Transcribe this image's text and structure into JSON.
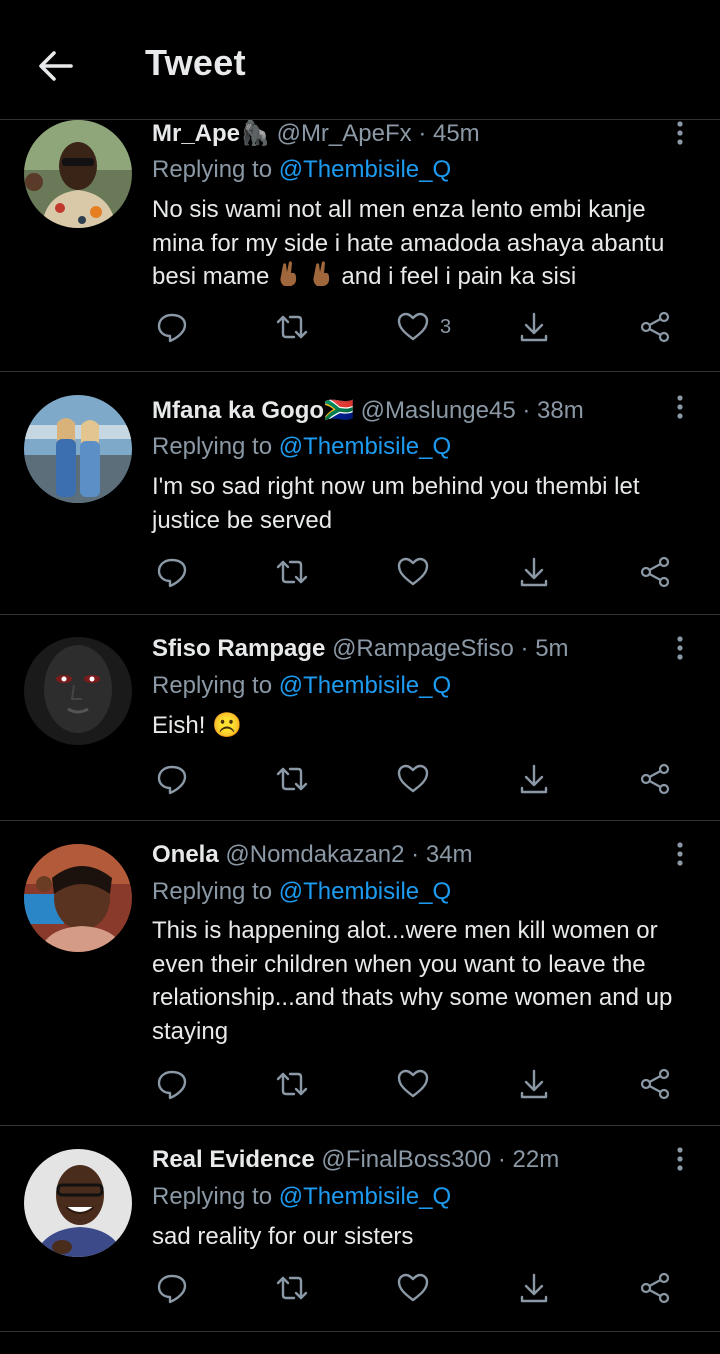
{
  "header": {
    "title": "Tweet"
  },
  "tweets": [
    {
      "name": "Mr_Ape🦍",
      "handle": "@Mr_ApeFx",
      "dot": "·",
      "time": "45m",
      "replying_prefix": "Replying to",
      "replying_to": "@Thembisile_Q",
      "text_line1": "No sis wami not all men enza lento embi kanje mina for my side i hate amadoda ashaya abantu besi mame",
      "text_line2": "and i feel i pain ka sisi",
      "like_count": "3"
    },
    {
      "name": "Mfana ka Gogo🇿🇦",
      "handle": "@Maslunge45",
      "dot": "·",
      "time": "38m",
      "replying_prefix": "Replying to",
      "replying_to": "@Thembisile_Q",
      "text": "I'm so sad right now um behind you thembi let justice be served"
    },
    {
      "name": "Sfiso Rampage",
      "handle": "@RampageSfiso",
      "dot": "·",
      "time": "5m",
      "replying_prefix": "Replying to",
      "replying_to": "@Thembisile_Q",
      "text": "Eish! ☹️"
    },
    {
      "name": "Onela",
      "handle": "@Nomdakazan2",
      "dot": "·",
      "time": "34m",
      "replying_prefix": "Replying to",
      "replying_to": "@Thembisile_Q",
      "text": "This is happening alot...were men kill women or even their children when you want to leave the relationship...and thats why some women and up staying"
    },
    {
      "name": "Real Evidence",
      "handle": "@FinalBoss300",
      "dot": "·",
      "time": "22m",
      "replying_prefix": "Replying to",
      "replying_to": "@Thembisile_Q",
      "text": "sad reality for our sisters"
    }
  ],
  "icons": {
    "back": "arrow-left-icon",
    "reply": "reply-icon",
    "retweet": "retweet-icon",
    "like": "heart-icon",
    "bookmark": "download-icon",
    "share": "share-icon",
    "more": "more-vertical-icon"
  },
  "colors": {
    "background": "#000000",
    "text": "#e7e9ea",
    "secondary": "#8b98a5",
    "accent": "#1d9bf0",
    "divider": "#2f3336"
  }
}
